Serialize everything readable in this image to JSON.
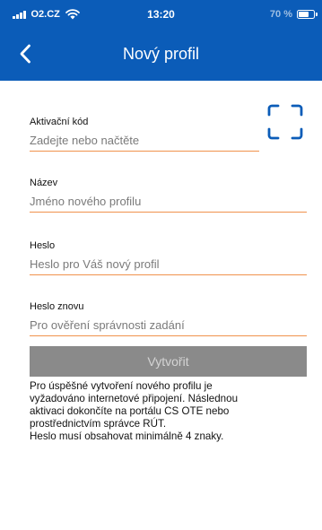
{
  "status_bar": {
    "carrier": "O2.CZ",
    "time": "13:20",
    "battery": "70 %",
    "icons": [
      "signal-icon",
      "wifi-icon",
      "battery-icon"
    ]
  },
  "header": {
    "title": "Nový profil",
    "back_icon": "chevron-left-icon"
  },
  "form": {
    "activation_code": {
      "label": "Aktivační kód",
      "placeholder": "Zadejte nebo načtěte"
    },
    "name": {
      "label": "Název",
      "placeholder": "Jméno nového profilu"
    },
    "password": {
      "label": "Heslo",
      "placeholder": "Heslo pro Váš nový profil"
    },
    "password_again": {
      "label": "Heslo znovu",
      "placeholder": "Pro ověření správnosti zadání"
    },
    "scan_icon": "scan-frame-icon",
    "create_label": "Vytvořit"
  },
  "info": {
    "text": "Pro úspěšné vytvoření nového profilu je\nvyžadováno internetové připojení. Následnou\naktivaci dokončíte na portálu CS OTE nebo\nprostřednictvím správce RÚT.\nHeslo musí obsahovat minimálně 4 znaky."
  },
  "colors": {
    "header_bg": "#0b5cb8",
    "accent_underline": "#f0924d",
    "button_bg": "#8a8a8a",
    "button_text": "#d4d4d4"
  }
}
